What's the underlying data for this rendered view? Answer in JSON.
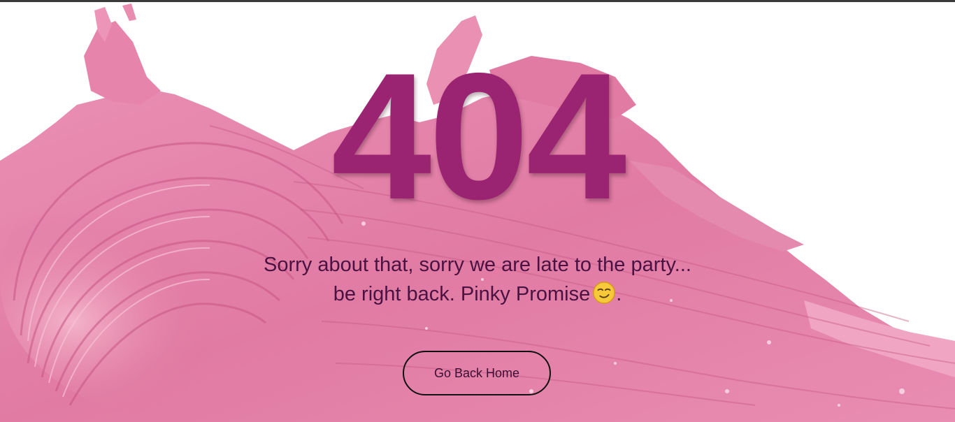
{
  "error": {
    "code": "404",
    "line1": "Sorry about that, sorry we are late to the party...",
    "line2": "be right back. Pinky Promise",
    "line2_suffix": ".",
    "emoji_icon": "smirking-face-icon"
  },
  "actions": {
    "home_label": "Go Back Home"
  },
  "colors": {
    "code": "#9b2472",
    "text": "#4a1242",
    "smear_base": "#e27aa3",
    "smear_light": "#f3a9c6",
    "smear_dark": "#c9557f",
    "background": "#ffffff"
  }
}
